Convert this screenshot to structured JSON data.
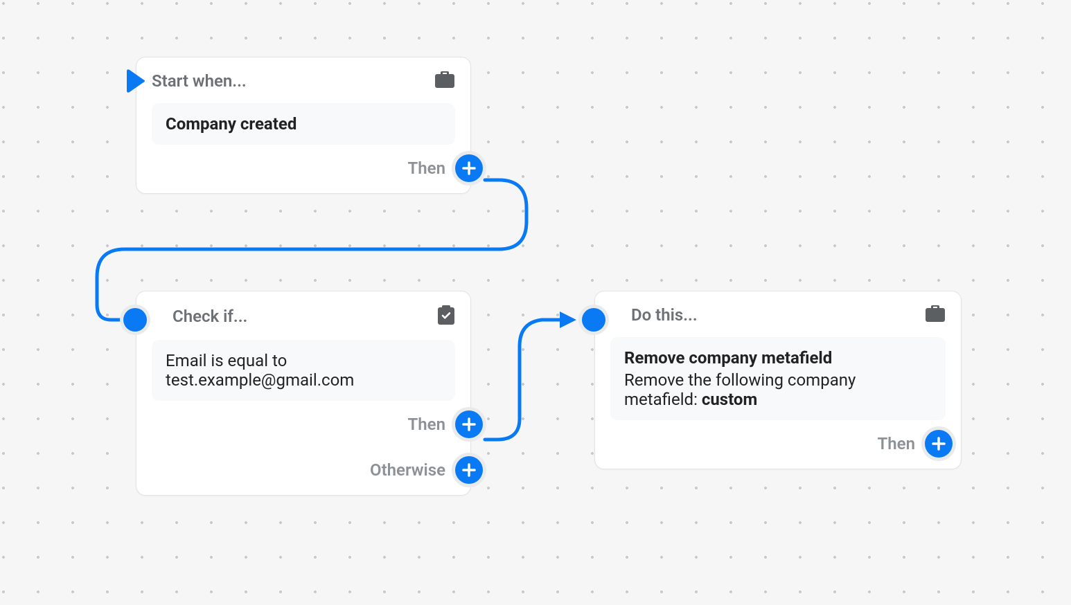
{
  "labels": {
    "then": "Then",
    "otherwise": "Otherwise"
  },
  "trigger": {
    "header": "Start when...",
    "event": "Company created"
  },
  "condition": {
    "header": "Check if...",
    "rule": "Email is equal to test.example@gmail.com"
  },
  "action": {
    "header": "Do this...",
    "title": "Remove company metafield",
    "description_prefix": "Remove the following company metafield: ",
    "description_bold": "custom"
  }
}
